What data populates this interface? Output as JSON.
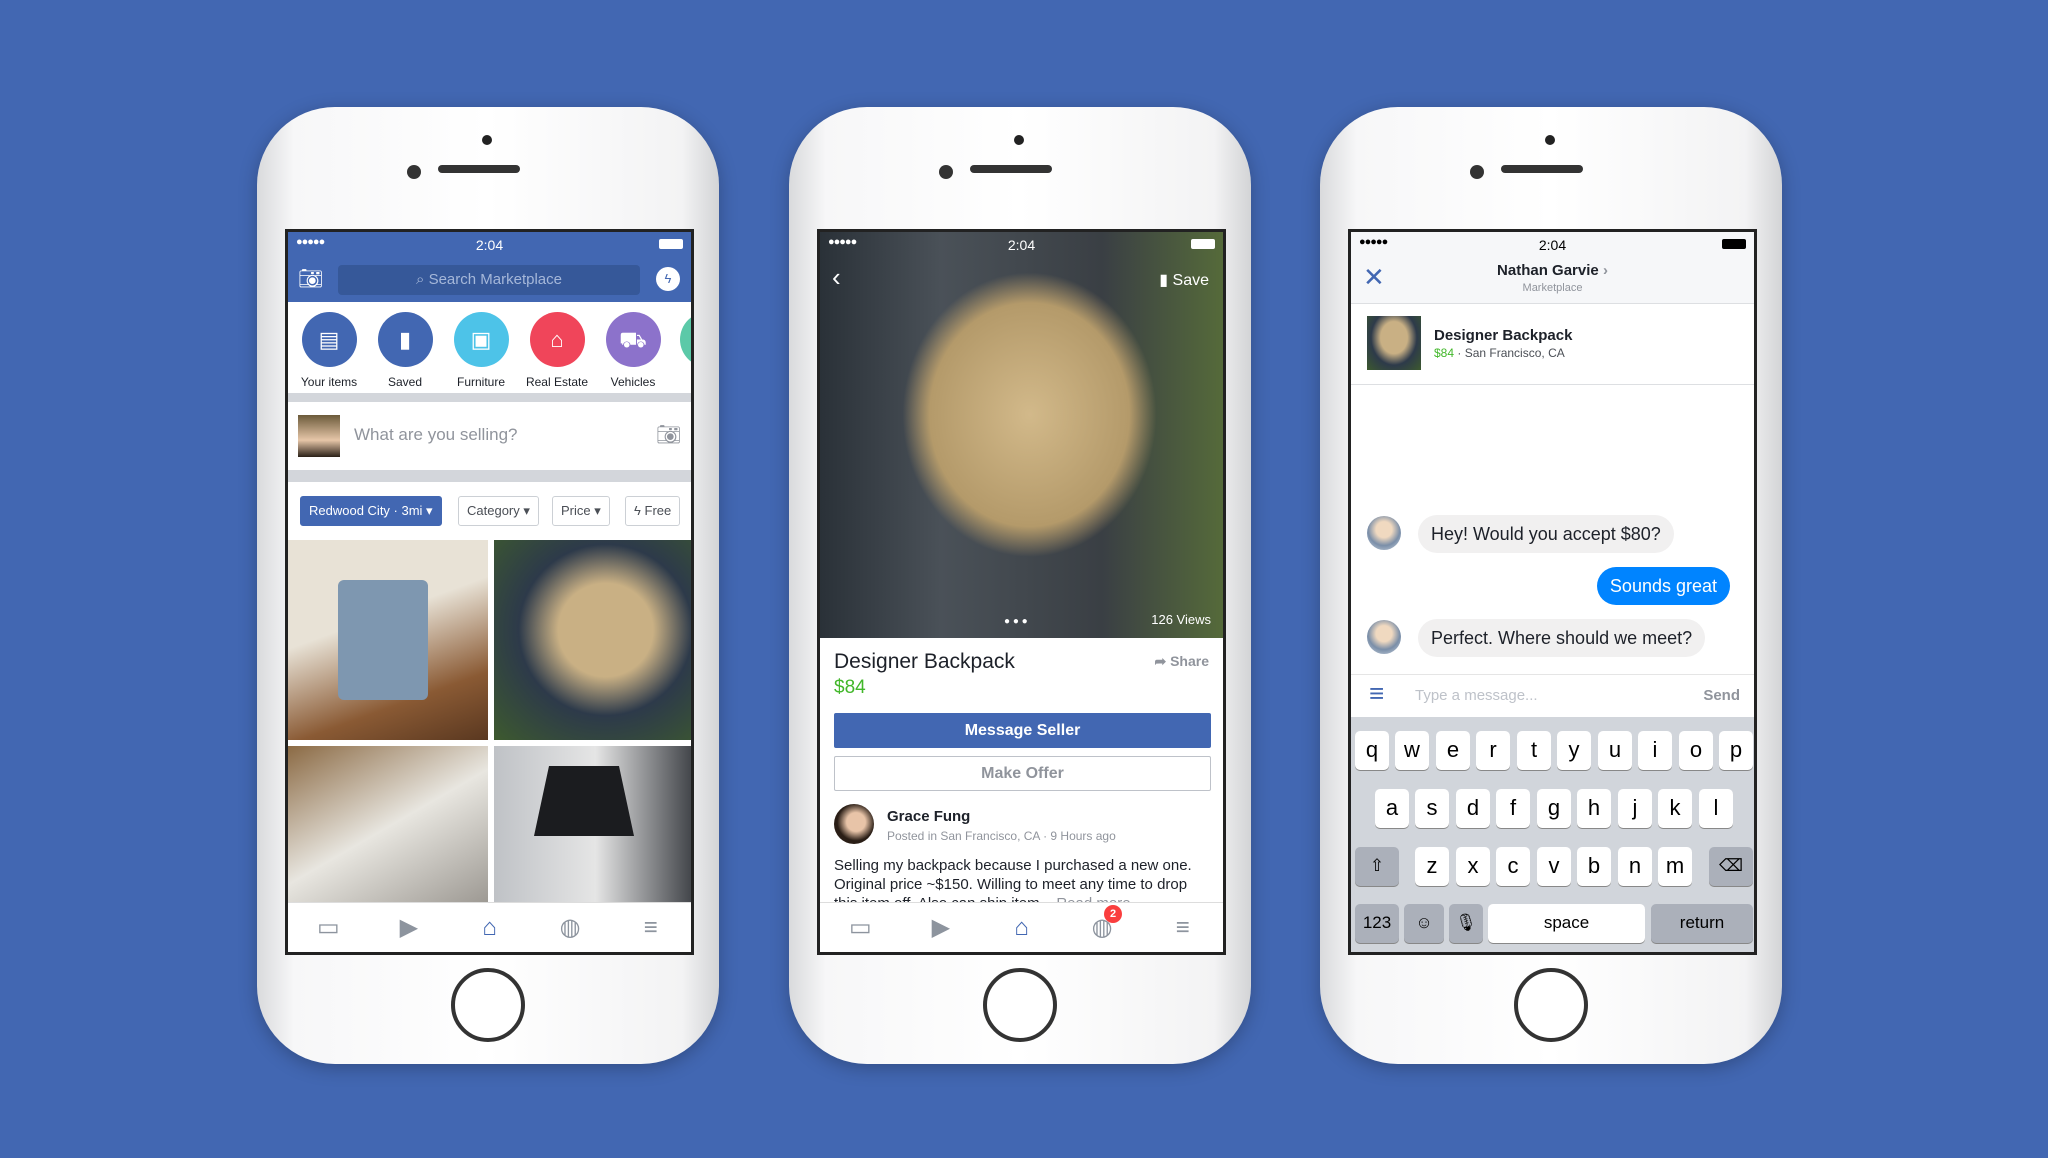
{
  "colors": {
    "background": "#4267b2",
    "brand": "#4267b2",
    "price": "#42b72a",
    "messenger": "#0084ff",
    "badge": "#fa3e3e"
  },
  "status": {
    "time": "2:04",
    "signal": "●●●●● ",
    "wifi": "wifi-icon"
  },
  "browse": {
    "search_placeholder": "Search Marketplace",
    "categories": [
      {
        "label": "Your items",
        "icon": "box-icon",
        "color": "#4267b2"
      },
      {
        "label": "Saved",
        "icon": "bookmark-icon",
        "color": "#4267b2"
      },
      {
        "label": "Furniture",
        "icon": "sofa-icon",
        "color": "#4dc3e8"
      },
      {
        "label": "Real Estate",
        "icon": "house-icon",
        "color": "#f0455a"
      },
      {
        "label": "Vehicles",
        "icon": "car-icon",
        "color": "#8c72cb"
      }
    ],
    "sell_placeholder": "What are you selling?",
    "filters": {
      "location": "Redwood City · 3mi",
      "category": "Category",
      "price": "Price",
      "free": "Free"
    }
  },
  "listing": {
    "title": "Designer Backpack",
    "price": "$84",
    "save": "Save",
    "share": "Share",
    "views": "126 Views",
    "message_seller": "Message Seller",
    "make_offer": "Make Offer",
    "seller": "Grace Fung",
    "posted": "Posted in San Francisco, CA · 9 Hours ago",
    "description": "Selling my backpack because I purchased a new one. Original price ~$150. Willing to meet any time to drop this item off. Also can ship item...",
    "read_more": "Read more",
    "notification_count": "2"
  },
  "chat": {
    "name": "Nathan Garvie",
    "subtitle": "Marketplace",
    "item_title": "Designer Backpack",
    "item_price": "$84",
    "item_location": " · San Francisco, CA",
    "messages": [
      {
        "from": "them",
        "text": "Hey! Would you accept $80?"
      },
      {
        "from": "me",
        "text": "Sounds great"
      },
      {
        "from": "them",
        "text": "Perfect. Where should we meet?"
      }
    ],
    "input_placeholder": "Type a message...",
    "send": "Send",
    "keyboard": {
      "row1": [
        "q",
        "w",
        "e",
        "r",
        "t",
        "y",
        "u",
        "i",
        "o",
        "p"
      ],
      "row2": [
        "a",
        "s",
        "d",
        "f",
        "g",
        "h",
        "j",
        "k",
        "l"
      ],
      "row3": [
        "z",
        "x",
        "c",
        "v",
        "b",
        "n",
        "m"
      ],
      "numbers": "123",
      "space": "space",
      "return": "return"
    }
  }
}
